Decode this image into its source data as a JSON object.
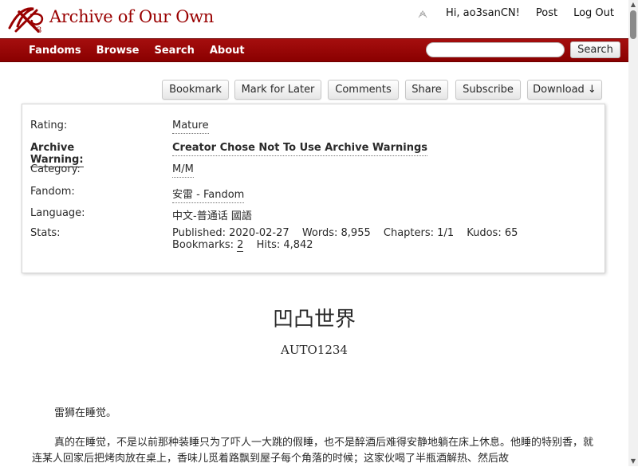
{
  "header": {
    "site_title": "Archive of Our Own",
    "greeting": "Hi, ao3sanCN!",
    "post": "Post",
    "logout": "Log Out"
  },
  "nav": {
    "items": [
      "Fandoms",
      "Browse",
      "Search",
      "About"
    ],
    "search_button": "Search",
    "search_placeholder": ""
  },
  "actions": {
    "bookmark": "Bookmark",
    "mark_for_later": "Mark for Later",
    "comments": "Comments",
    "share": "Share",
    "subscribe": "Subscribe",
    "download": "Download ↓"
  },
  "meta": {
    "rating_label": "Rating:",
    "rating": "Mature",
    "warning_label": "Archive Warning:",
    "warning": "Creator Chose Not To Use Archive Warnings",
    "category_label": "Category:",
    "category": "M/M",
    "fandom_label": "Fandom:",
    "fandom": "安雷 - Fandom",
    "language_label": "Language:",
    "language": "中文-普通话 國語",
    "stats_label": "Stats:",
    "stats": {
      "published_label": "Published:",
      "published": "2020-02-27",
      "words_label": "Words:",
      "words": "8,955",
      "chapters_label": "Chapters:",
      "chapters": "1/1",
      "kudos_label": "Kudos:",
      "kudos": "65",
      "bookmarks_label": "Bookmarks:",
      "bookmarks": "2",
      "hits_label": "Hits:",
      "hits": "4,842"
    }
  },
  "work": {
    "title": "凹凸世界",
    "author": "AUTO1234",
    "paragraphs": [
      "雷狮在睡觉。",
      "真的在睡觉，不是以前那种装睡只为了吓人一大跳的假睡，也不是醉酒后难得安静地躺在床上休息。他睡的特别香，就连某人回家后把烤肉放在桌上，香味儿觅着路飘到屋子每个角落的时候；这家伙喝了半瓶酒解热、然后故"
    ]
  },
  "colors": {
    "brand_red": "#990000",
    "nav_red": "#a50e0e"
  }
}
